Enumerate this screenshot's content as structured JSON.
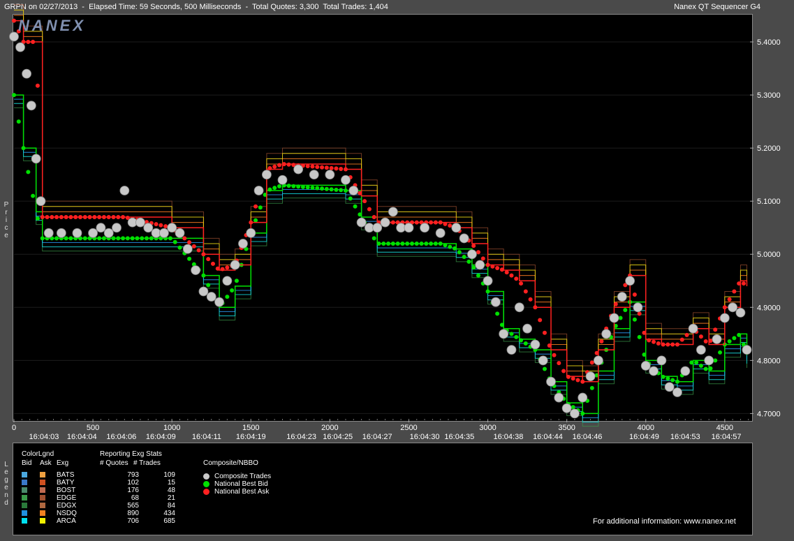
{
  "header": {
    "title": "GRPN on 02/27/2013  -  Elapsed Time: 59 Seconds, 500 Milliseconds  -  Total Quotes: 3,300  Total Trades: 1,404",
    "app_name": "Nanex QT Sequencer G4"
  },
  "watermark": "NANEX",
  "axis": {
    "y_title": "Price",
    "legend_side_title": "Legend"
  },
  "chart_data": {
    "type": "line",
    "xlim": [
      0,
      4660
    ],
    "ylim": [
      4.69,
      5.45
    ],
    "x_ticks": [
      0,
      500,
      1000,
      1500,
      2000,
      2500,
      3000,
      3500,
      4000,
      4500
    ],
    "y_ticks": [
      "5.4000",
      "5.3000",
      "5.2000",
      "5.1000",
      "5.0000",
      "4.9000",
      "4.8000",
      "4.7000"
    ],
    "y_tick_values": [
      5.4,
      5.3,
      5.2,
      5.1,
      5.0,
      4.9,
      4.8,
      4.7
    ],
    "time_labels": [
      {
        "x": 190,
        "label": "16:04:03"
      },
      {
        "x": 430,
        "label": "16:04:04"
      },
      {
        "x": 680,
        "label": "16:04:06"
      },
      {
        "x": 930,
        "label": "16:04:09"
      },
      {
        "x": 1220,
        "label": "16:04:11"
      },
      {
        "x": 1500,
        "label": "16:04:19"
      },
      {
        "x": 1820,
        "label": "16:04:23"
      },
      {
        "x": 2050,
        "label": "16:04:25"
      },
      {
        "x": 2300,
        "label": "16:04:27"
      },
      {
        "x": 2600,
        "label": "16:04:30"
      },
      {
        "x": 2820,
        "label": "16:04:35"
      },
      {
        "x": 3130,
        "label": "16:04:38"
      },
      {
        "x": 3380,
        "label": "16:04:44"
      },
      {
        "x": 3630,
        "label": "16:04:46"
      },
      {
        "x": 3990,
        "label": "16:04:49"
      },
      {
        "x": 4250,
        "label": "16:04:53"
      },
      {
        "x": 4510,
        "label": "16:04:57"
      }
    ],
    "series": [
      {
        "name": "Composite Trades",
        "color": "#c8c8c8",
        "x": [
          0,
          40,
          80,
          110,
          140,
          170,
          220,
          300,
          400,
          500,
          550,
          600,
          650,
          700,
          750,
          800,
          850,
          900,
          950,
          1000,
          1050,
          1100,
          1150,
          1200,
          1250,
          1300,
          1350,
          1400,
          1450,
          1500,
          1550,
          1600,
          1700,
          1800,
          1900,
          2000,
          2100,
          2150,
          2200,
          2250,
          2300,
          2350,
          2400,
          2450,
          2500,
          2600,
          2700,
          2800,
          2850,
          2900,
          2950,
          3000,
          3050,
          3100,
          3150,
          3200,
          3250,
          3300,
          3350,
          3400,
          3450,
          3500,
          3550,
          3600,
          3650,
          3700,
          3750,
          3800,
          3850,
          3900,
          3950,
          4000,
          4050,
          4100,
          4150,
          4200,
          4250,
          4300,
          4350,
          4400,
          4450,
          4500,
          4550,
          4600,
          4640
        ],
        "y": [
          5.41,
          5.39,
          5.34,
          5.28,
          5.18,
          5.1,
          5.04,
          5.04,
          5.04,
          5.04,
          5.05,
          5.04,
          5.05,
          5.12,
          5.06,
          5.06,
          5.05,
          5.04,
          5.04,
          5.05,
          5.04,
          5.01,
          4.97,
          4.93,
          4.92,
          4.91,
          4.95,
          4.98,
          5.02,
          5.04,
          5.12,
          5.15,
          5.14,
          5.16,
          5.15,
          5.15,
          5.14,
          5.12,
          5.06,
          5.05,
          5.05,
          5.06,
          5.08,
          5.05,
          5.05,
          5.05,
          5.04,
          5.05,
          5.03,
          5.0,
          4.98,
          4.95,
          4.91,
          4.85,
          4.82,
          4.9,
          4.86,
          4.83,
          4.8,
          4.76,
          4.73,
          4.71,
          4.7,
          4.73,
          4.77,
          4.8,
          4.85,
          4.88,
          4.92,
          4.95,
          4.9,
          4.79,
          4.78,
          4.8,
          4.75,
          4.74,
          4.78,
          4.86,
          4.82,
          4.8,
          4.84,
          4.88,
          4.9,
          4.89,
          4.82
        ]
      },
      {
        "name": "National Best Bid",
        "color": "#00e000",
        "x": [
          0,
          60,
          140,
          180,
          700,
          1000,
          1200,
          1300,
          1400,
          1500,
          1600,
          1700,
          2100,
          2200,
          2300,
          2500,
          2700,
          2800,
          2900,
          3000,
          3100,
          3200,
          3300,
          3400,
          3500,
          3600,
          3700,
          3800,
          3900,
          4000,
          4100,
          4200,
          4300,
          4400,
          4500,
          4600,
          4640
        ],
        "y": [
          5.3,
          5.2,
          5.08,
          5.03,
          5.03,
          5.03,
          4.96,
          4.9,
          4.94,
          5.04,
          5.12,
          5.13,
          5.12,
          5.07,
          5.02,
          5.02,
          5.02,
          5.01,
          4.98,
          4.93,
          4.86,
          4.84,
          4.82,
          4.76,
          4.72,
          4.7,
          4.78,
          4.86,
          4.91,
          4.8,
          4.77,
          4.76,
          4.8,
          4.78,
          4.83,
          4.85,
          4.81
        ]
      },
      {
        "name": "National Best Ask",
        "color": "#ff2020",
        "x": [
          0,
          60,
          140,
          180,
          700,
          1000,
          1200,
          1300,
          1400,
          1500,
          1600,
          1700,
          2100,
          2200,
          2300,
          2500,
          2700,
          2800,
          2900,
          3000,
          3100,
          3200,
          3300,
          3400,
          3500,
          3600,
          3700,
          3800,
          3900,
          4000,
          4100,
          4200,
          4300,
          4400,
          4500,
          4600,
          4640
        ],
        "y": [
          5.44,
          5.4,
          5.4,
          5.07,
          5.07,
          5.05,
          5.0,
          4.97,
          4.98,
          5.06,
          5.16,
          5.17,
          5.16,
          5.11,
          5.06,
          5.06,
          5.06,
          5.05,
          5.02,
          4.98,
          4.97,
          4.95,
          4.9,
          4.82,
          4.77,
          4.76,
          4.82,
          4.9,
          4.96,
          4.84,
          4.83,
          4.83,
          4.86,
          4.83,
          4.9,
          4.95,
          4.94
        ]
      }
    ]
  },
  "legend": {
    "color_legend_label": "ColorLgnd",
    "col_bid": "Bid",
    "col_ask": "Ask",
    "col_exg": "Exg",
    "stats_label": "Reporting Exg Stats",
    "col_quotes": "# Quotes",
    "col_trades": "# Trades",
    "composite_label": "Composite/NBBO",
    "rows": [
      {
        "exg": "BATS",
        "quotes": "793",
        "trades": "109",
        "bid_color": "#4aa8e0",
        "ask_color": "#f0a040"
      },
      {
        "exg": "BATY",
        "quotes": "102",
        "trades": "15",
        "bid_color": "#3a78c8",
        "ask_color": "#d05020"
      },
      {
        "exg": "BOST",
        "quotes": "176",
        "trades": "48",
        "bid_color": "#4a8a6a",
        "ask_color": "#c06a50"
      },
      {
        "exg": "EDGE",
        "quotes": "68",
        "trades": "21",
        "bid_color": "#3a9a4a",
        "ask_color": "#a05030"
      },
      {
        "exg": "EDGX",
        "quotes": "565",
        "trades": "84",
        "bid_color": "#2a7a3a",
        "ask_color": "#b06840"
      },
      {
        "exg": "NSDQ",
        "quotes": "890",
        "trades": "434",
        "bid_color": "#2090e0",
        "ask_color": "#f08020"
      },
      {
        "exg": "ARCA",
        "quotes": "706",
        "trades": "685",
        "bid_color": "#00e0f0",
        "ask_color": "#f0f000"
      }
    ],
    "composite_items": [
      {
        "label": "Composite Trades",
        "color": "#c8c8c8"
      },
      {
        "label": "National Best Bid",
        "color": "#00e000"
      },
      {
        "label": "National Best Ask",
        "color": "#ff2020"
      }
    ],
    "footer": "For additional information: www.nanex.net"
  }
}
